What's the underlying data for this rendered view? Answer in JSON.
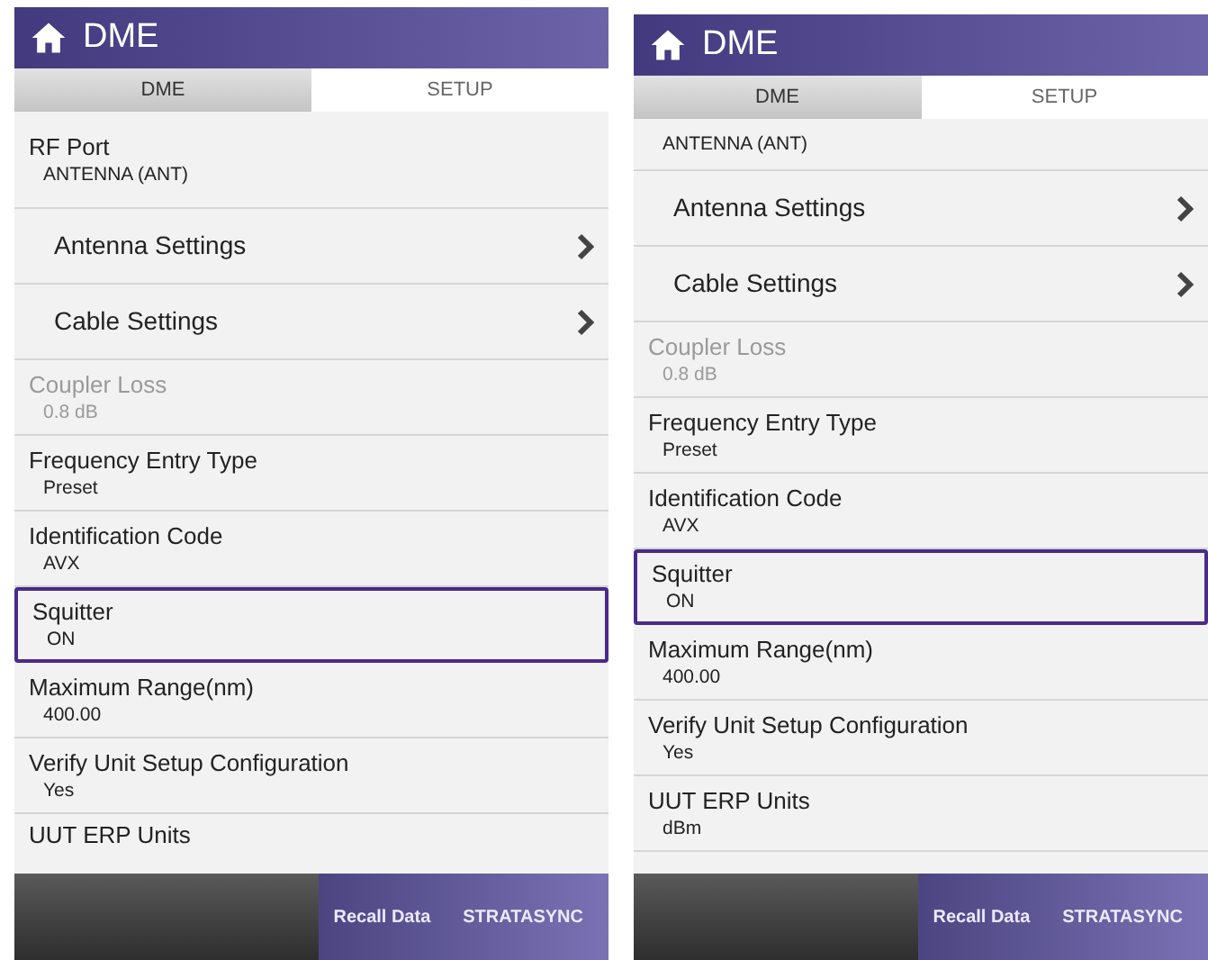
{
  "screens": [
    {
      "title": "DME",
      "tabs": [
        {
          "label": "DME",
          "selected": false
        },
        {
          "label": "SETUP",
          "selected": true
        }
      ],
      "rows": [
        {
          "kind": "setting",
          "label": "RF Port",
          "value": "ANTENNA (ANT)",
          "disabled": false,
          "selected": false
        },
        {
          "kind": "link",
          "label": "Antenna Settings"
        },
        {
          "kind": "link",
          "label": "Cable Settings"
        },
        {
          "kind": "setting",
          "label": "Coupler Loss",
          "value": "0.8 dB",
          "disabled": true,
          "selected": false
        },
        {
          "kind": "setting",
          "label": "Frequency Entry Type",
          "value": "Preset",
          "disabled": false,
          "selected": false
        },
        {
          "kind": "setting",
          "label": "Identification Code",
          "value": "AVX",
          "disabled": false,
          "selected": false
        },
        {
          "kind": "setting",
          "label": "Squitter",
          "value": "ON",
          "disabled": false,
          "selected": true
        },
        {
          "kind": "setting",
          "label": "Maximum Range(nm)",
          "value": "400.00",
          "disabled": false,
          "selected": false
        },
        {
          "kind": "setting",
          "label": "Verify Unit Setup Configuration",
          "value": "Yes",
          "disabled": false,
          "selected": false
        },
        {
          "kind": "setting",
          "label": "UUT ERP Units",
          "disabled": false,
          "selected": false
        }
      ],
      "footer_buttons": [
        "Recall Data",
        "STRATASYNC"
      ]
    },
    {
      "title": "DME",
      "tabs": [
        {
          "label": "DME",
          "selected": false
        },
        {
          "label": "SETUP",
          "selected": true
        }
      ],
      "rows": [
        {
          "kind": "setting",
          "value": "ANTENNA (ANT)",
          "disabled": false,
          "selected": false
        },
        {
          "kind": "link",
          "label": "Antenna Settings"
        },
        {
          "kind": "link",
          "label": "Cable Settings"
        },
        {
          "kind": "setting",
          "label": "Coupler Loss",
          "value": "0.8 dB",
          "disabled": true,
          "selected": false
        },
        {
          "kind": "setting",
          "label": "Frequency Entry Type",
          "value": "Preset",
          "disabled": false,
          "selected": false
        },
        {
          "kind": "setting",
          "label": "Identification Code",
          "value": "AVX",
          "disabled": false,
          "selected": false
        },
        {
          "kind": "setting",
          "label": "Squitter",
          "value": "ON",
          "disabled": false,
          "selected": true
        },
        {
          "kind": "setting",
          "label": "Maximum Range(nm)",
          "value": "400.00",
          "disabled": false,
          "selected": false
        },
        {
          "kind": "setting",
          "label": "Verify Unit Setup Configuration",
          "value": "Yes",
          "disabled": false,
          "selected": false
        },
        {
          "kind": "setting",
          "label": "UUT ERP Units",
          "value": "dBm",
          "disabled": false,
          "selected": false
        }
      ],
      "footer_buttons": [
        "Recall Data",
        "STRATASYNC"
      ]
    }
  ]
}
